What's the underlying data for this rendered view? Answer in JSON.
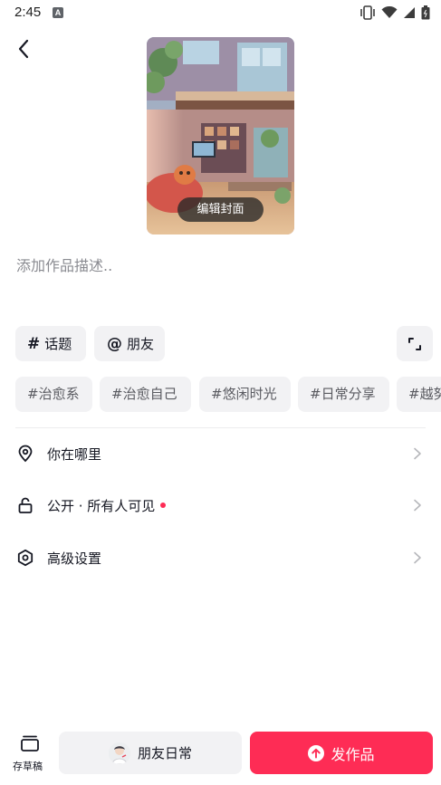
{
  "status_bar": {
    "time": "2:45",
    "notification_letter": "A",
    "icons": [
      "vibrate-icon",
      "wifi-icon",
      "signal-icon",
      "battery-icon"
    ]
  },
  "header": {
    "back_icon": "chevron-left-icon"
  },
  "cover": {
    "edit_label": "编辑封面"
  },
  "description": {
    "placeholder": "添加作品描述.."
  },
  "chips": {
    "topic": {
      "symbol": "#",
      "label": "话题"
    },
    "friend": {
      "symbol": "@",
      "label": "朋友"
    },
    "expand_icon": "expand-icon"
  },
  "tags": [
    "#治愈系",
    "#治愈自己",
    "#悠闲时光",
    "#日常分享",
    "#越努"
  ],
  "settings": [
    {
      "icon": "location-pin-icon",
      "label": "你在哪里"
    },
    {
      "icon": "unlock-icon",
      "label": "公开 · 所有人可见",
      "dot": true
    },
    {
      "icon": "hexagon-settings-icon",
      "label": "高级设置"
    }
  ],
  "bottom": {
    "draft_label": "存草稿",
    "daily_label": "朋友日常",
    "publish_label": "发作品"
  },
  "colors": {
    "accent": "#fe2c55",
    "chip_bg": "#f2f2f4",
    "text": "#161823",
    "muted": "#8a8b91"
  }
}
